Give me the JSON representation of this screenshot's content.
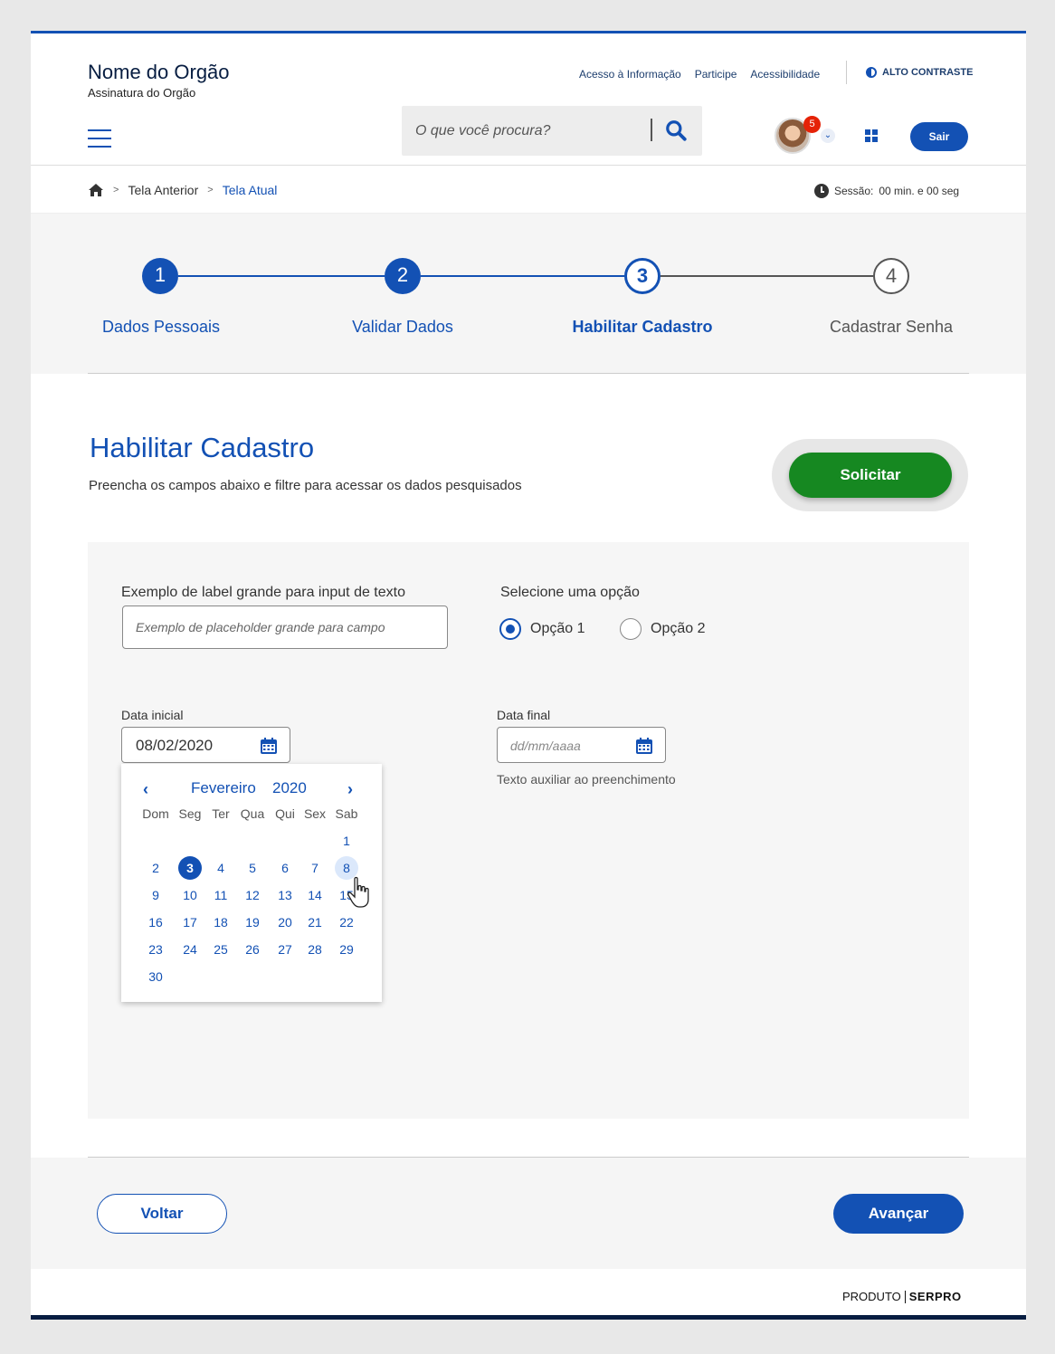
{
  "header": {
    "org_name": "Nome do Orgão",
    "org_signature": "Assinatura do Orgão",
    "links": [
      "Acesso à Informação",
      "Participe",
      "Acessibilidade"
    ],
    "contrast_label": "ALTO CONTRASTE",
    "search_placeholder": "O que você procura?",
    "notification_count": "5",
    "logout_label": "Sair"
  },
  "breadcrumb": {
    "previous": "Tela Anterior",
    "current": "Tela Atual"
  },
  "session": {
    "label": "Sessão:",
    "value": "00 min. e 00 seg"
  },
  "stepper": {
    "steps": [
      {
        "number": "1",
        "label": "Dados Pessoais",
        "state": "done"
      },
      {
        "number": "2",
        "label": "Validar Dados",
        "state": "done"
      },
      {
        "number": "3",
        "label": "Habilitar Cadastro",
        "state": "active"
      },
      {
        "number": "4",
        "label": "Cadastrar Senha",
        "state": "pending"
      }
    ]
  },
  "section": {
    "title": "Habilitar Cadastro",
    "subtitle": "Preencha os campos abaixo e filtre para acessar os dados pesquisados",
    "action_label": "Solicitar"
  },
  "form": {
    "text_label": "Exemplo de label grande para input de texto",
    "text_placeholder": "Exemplo de placeholder grande para campo",
    "radio_label": "Selecione uma opção",
    "radio_options": [
      "Opção 1",
      "Opção 2"
    ],
    "radio_selected": "Opção 1",
    "start_date_label": "Data inicial",
    "start_date_value": "08/02/2020",
    "end_date_label": "Data final",
    "end_date_placeholder": "dd/mm/aaaa",
    "end_date_helper": "Texto auxiliar ao preenchimento"
  },
  "datepicker": {
    "month": "Fevereiro",
    "year": "2020",
    "weekdays": [
      "Dom",
      "Seg",
      "Ter",
      "Qua",
      "Qui",
      "Sex",
      "Sab"
    ],
    "selected_day": "3",
    "hover_day": "8",
    "weeks": [
      [
        "",
        "",
        "",
        "",
        "",
        "",
        "1"
      ],
      [
        "2",
        "3",
        "4",
        "5",
        "6",
        "7",
        "8"
      ],
      [
        "9",
        "10",
        "11",
        "12",
        "13",
        "14",
        "15"
      ],
      [
        "16",
        "17",
        "18",
        "19",
        "20",
        "21",
        "22"
      ],
      [
        "23",
        "24",
        "25",
        "26",
        "27",
        "28",
        "29"
      ],
      [
        "30",
        "",
        "",
        "",
        "",
        "",
        ""
      ]
    ]
  },
  "footer_nav": {
    "back_label": "Voltar",
    "next_label": "Avançar"
  },
  "footer": {
    "product_label": "PRODUTO",
    "brand": "SERPRO"
  },
  "colors": {
    "primary": "#1351b4",
    "success": "#168821",
    "danger": "#e52207",
    "dark_blue": "#071d41"
  }
}
